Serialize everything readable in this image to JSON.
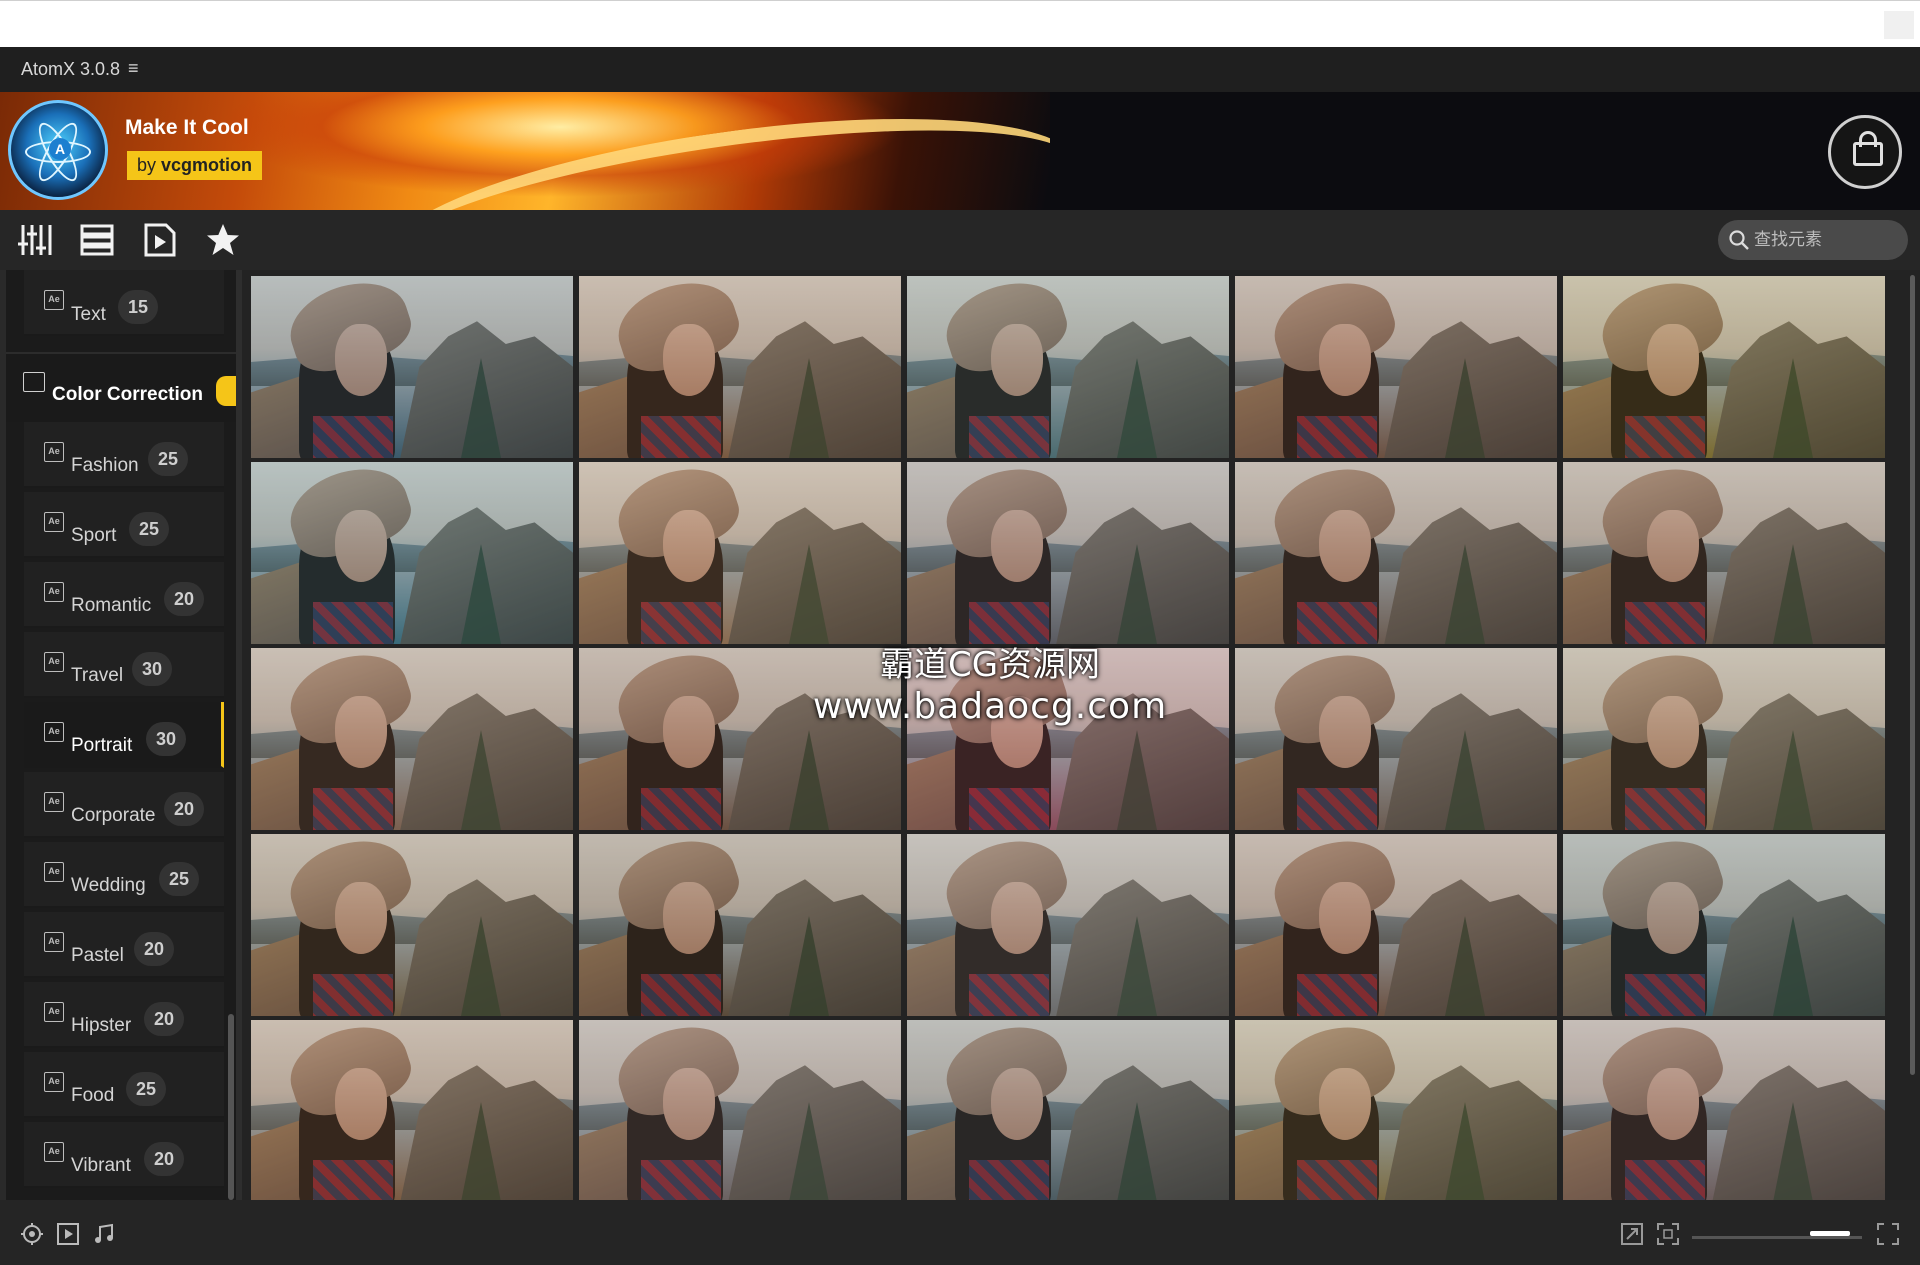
{
  "app": {
    "title": "AtomX 3.0.8",
    "menu_icon": "hamburger-icon"
  },
  "banner": {
    "pack_name": "Make It Cool",
    "by": "by",
    "author": "vcgmotion",
    "cart_icon": "shopping-bag-icon"
  },
  "toolbar": {
    "tools": [
      "sliders-icon",
      "list-view-icon",
      "play-file-icon",
      "star-icon"
    ],
    "search": {
      "placeholder": "查找元素",
      "value": ""
    }
  },
  "sidebar": {
    "top_item": {
      "label": "Text",
      "count": "15"
    },
    "category": {
      "label": "Color Correction"
    },
    "items": [
      {
        "label": "Fashion",
        "count": "25"
      },
      {
        "label": "Sport",
        "count": "25"
      },
      {
        "label": "Romantic",
        "count": "20"
      },
      {
        "label": "Travel",
        "count": "30"
      },
      {
        "label": "Portrait",
        "count": "30",
        "active": true
      },
      {
        "label": "Corporate",
        "count": "20"
      },
      {
        "label": "Wedding",
        "count": "25"
      },
      {
        "label": "Pastel",
        "count": "20"
      },
      {
        "label": "Hipster",
        "count": "20"
      },
      {
        "label": "Food",
        "count": "25"
      },
      {
        "label": "Vibrant",
        "count": "20"
      }
    ]
  },
  "grid": {
    "rows": 5,
    "cols": 5,
    "tints": [
      [
        "#3b5a6a",
        "#7a5a40",
        "#4a6a70",
        "#6a5040",
        "#7a6a30"
      ],
      [
        "#3a6a7a",
        "#8a6a50",
        "#5a5a60",
        "#6a5a50",
        "#6a5a4a"
      ],
      [
        "#7a6050",
        "#6a5040",
        "#8a4a5a",
        "#6a5a50",
        "#7a6a50"
      ],
      [
        "#6a5a40",
        "#5a4a3a",
        "#6a6a6a",
        "#6a5040",
        "#3a5a60"
      ],
      [
        "#7a5a40",
        "#6a6060",
        "#4a5a60",
        "#7a6a40",
        "#6a5a5a"
      ]
    ]
  },
  "watermark": {
    "line1": "霸道CG资源网",
    "line2": "www.badaocg.com"
  },
  "bottombar": {
    "icons": [
      "target-icon",
      "video-preview-icon",
      "music-note-icon"
    ],
    "right_icons": [
      "expand-icon",
      "fit-icon",
      "fullscreen-icon"
    ],
    "zoom_slider_value": 0.75
  }
}
